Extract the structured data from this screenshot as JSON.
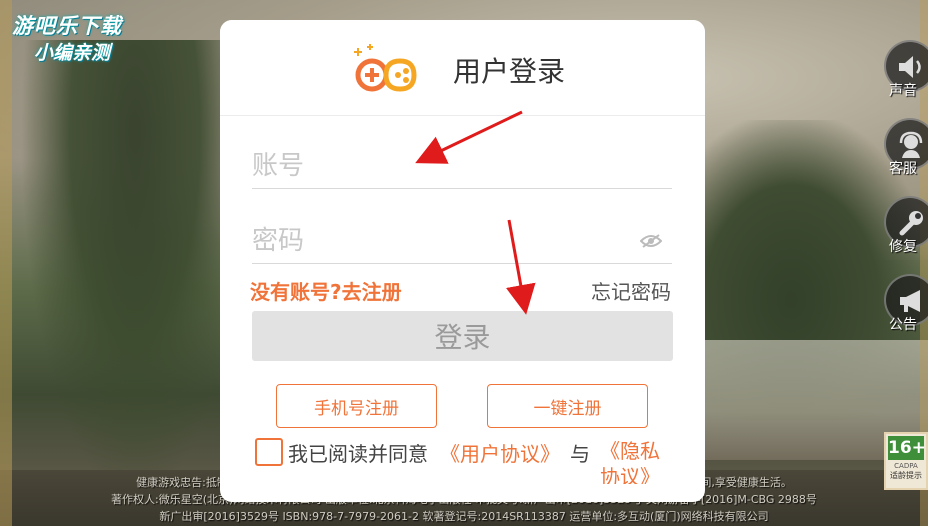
{
  "watermark": {
    "line1": "游吧乐下载",
    "line2": "小编亲测"
  },
  "card": {
    "title": "用户登录",
    "account_placeholder": "账号",
    "password_placeholder": "密码",
    "register_link": "没有账号?去注册",
    "forgot_link": "忘记密码",
    "login_button": "登录",
    "phone_register_button": "手机号注册",
    "quick_register_button": "一键注册",
    "agree_text": "我已阅读并同意",
    "user_agreement_link": "《用户协议》",
    "and_text": "与",
    "privacy_link": "《隐私协议》"
  },
  "side_buttons": [
    {
      "label": "声音",
      "icon": "speaker-icon"
    },
    {
      "label": "客服",
      "icon": "customer-service-icon"
    },
    {
      "label": "修复",
      "icon": "wrench-icon"
    },
    {
      "label": "公告",
      "icon": "megaphone-icon"
    }
  ],
  "age_badge": {
    "age": "16+",
    "org": "CADPA",
    "tip": "适龄提示"
  },
  "notice": {
    "line1": "健康游戏忠告:抵制不良游戏,拒绝盗版游戏。注意自我保护,谨防受骗上当。适度游戏益脑,沉迷游戏伤身。合理安排时间,享受健康生活。",
    "line2": "著作权人:微乐星空(北京)网络技术有限公司 出版单位:北京科海电子出版社 审批文号:新广出审[2016]3529号 文网游备字[2016]M-CBG 2988号",
    "line3": "新广出审[2016]3529号 ISBN:978-7-7979-2061-2 软著登记号:2014SR113387 运营单位:多互动(厦门)网络科技有限公司"
  },
  "colors": {
    "accent": "#f0743a",
    "card_bg": "#ffffff",
    "login_btn_bg": "#e2e2e2",
    "arrow": "#e01b1b"
  }
}
